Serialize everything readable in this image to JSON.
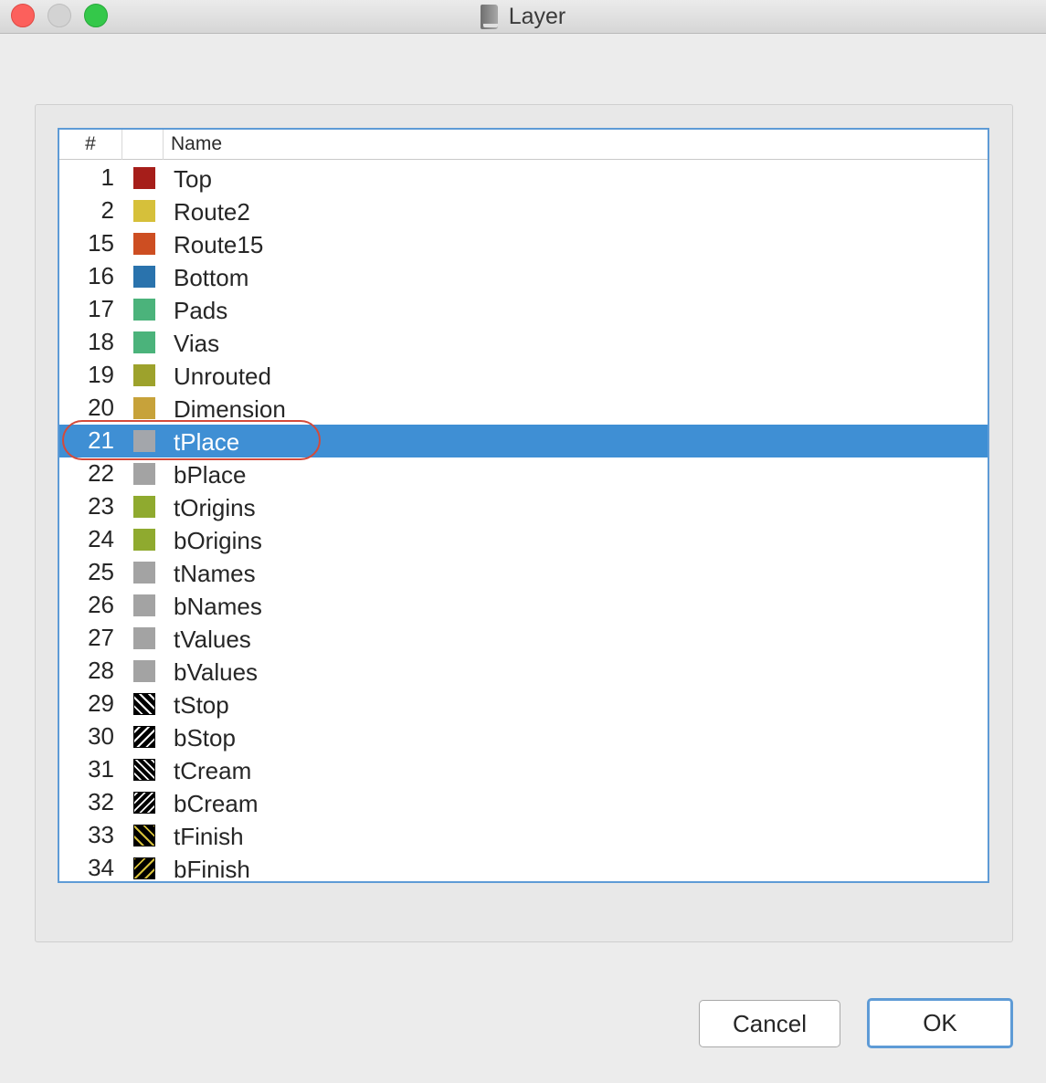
{
  "window": {
    "title": "Layer",
    "icon": "book-icon"
  },
  "table": {
    "columns": [
      "#",
      "",
      "Name"
    ],
    "selected_layer": "21",
    "rows": [
      {
        "num": "1",
        "name": "Top",
        "color": "#a61e1a",
        "pattern": "solid"
      },
      {
        "num": "2",
        "name": "Route2",
        "color": "#d6c03a",
        "pattern": "solid"
      },
      {
        "num": "15",
        "name": "Route15",
        "color": "#cd4e22",
        "pattern": "solid"
      },
      {
        "num": "16",
        "name": "Bottom",
        "color": "#2a73ad",
        "pattern": "solid"
      },
      {
        "num": "17",
        "name": "Pads",
        "color": "#4bb37b",
        "pattern": "solid"
      },
      {
        "num": "18",
        "name": "Vias",
        "color": "#4bb37b",
        "pattern": "solid"
      },
      {
        "num": "19",
        "name": "Unrouted",
        "color": "#9da22c",
        "pattern": "solid"
      },
      {
        "num": "20",
        "name": "Dimension",
        "color": "#c7a23a",
        "pattern": "solid"
      },
      {
        "num": "21",
        "name": "tPlace",
        "color": "#a3a6ab",
        "pattern": "solid"
      },
      {
        "num": "22",
        "name": "bPlace",
        "color": "#a3a3a3",
        "pattern": "solid"
      },
      {
        "num": "23",
        "name": "tOrigins",
        "color": "#8faa2f",
        "pattern": "solid"
      },
      {
        "num": "24",
        "name": "bOrigins",
        "color": "#8faa2f",
        "pattern": "solid"
      },
      {
        "num": "25",
        "name": "tNames",
        "color": "#a3a3a3",
        "pattern": "solid"
      },
      {
        "num": "26",
        "name": "bNames",
        "color": "#a3a3a3",
        "pattern": "solid"
      },
      {
        "num": "27",
        "name": "tValues",
        "color": "#a3a3a3",
        "pattern": "solid"
      },
      {
        "num": "28",
        "name": "bValues",
        "color": "#a3a3a3",
        "pattern": "solid"
      },
      {
        "num": "29",
        "name": "tStop",
        "color": "#000000",
        "pattern": "hatch-forward"
      },
      {
        "num": "30",
        "name": "bStop",
        "color": "#000000",
        "pattern": "hatch-back"
      },
      {
        "num": "31",
        "name": "tCream",
        "color": "#000000",
        "pattern": "dense-forward"
      },
      {
        "num": "32",
        "name": "bCream",
        "color": "#000000",
        "pattern": "dense-back"
      },
      {
        "num": "33",
        "name": "tFinish",
        "color": "#000000",
        "pattern": "finish-forward"
      },
      {
        "num": "34",
        "name": "bFinish",
        "color": "#000000",
        "pattern": "finish-back"
      }
    ]
  },
  "buttons": {
    "cancel": "Cancel",
    "ok": "OK"
  }
}
